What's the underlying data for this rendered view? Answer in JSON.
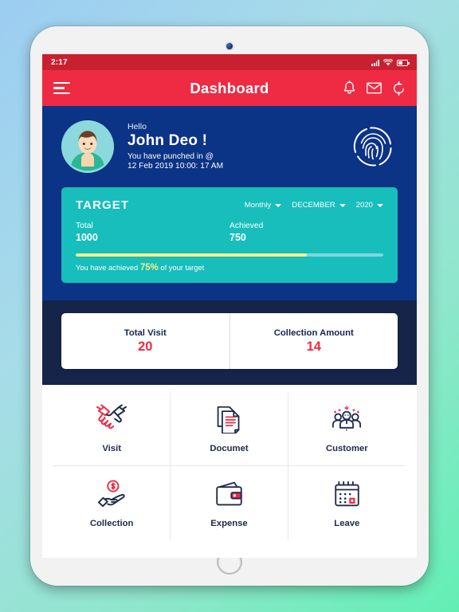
{
  "status_bar": {
    "time": "2:17",
    "signal_icon": "signal-bars-icon",
    "wifi_icon": "wifi-icon",
    "battery_icon": "battery-icon"
  },
  "app_bar": {
    "menu_icon": "hamburger-menu-icon",
    "title": "Dashboard",
    "notification_icon": "bell-icon",
    "mail_icon": "envelope-icon",
    "refresh_icon": "refresh-icon"
  },
  "profile": {
    "avatar_icon": "user-avatar",
    "hello": "Hello",
    "name": "John Deo !",
    "punch_line1": "You have punched in @",
    "punch_line2": "12 Feb 2019 10:00: 17 AM",
    "fingerprint_icon": "fingerprint-icon"
  },
  "target": {
    "title": "TARGET",
    "period": "Monthly",
    "month": "DECEMBER",
    "year": "2020",
    "total_label": "Total",
    "total_value": "1000",
    "achieved_label": "Achieved",
    "achieved_value": "750",
    "progress_percent": 75,
    "note_prefix": "You have achieved ",
    "note_percent": "75%",
    "note_suffix": " of your target"
  },
  "stats": [
    {
      "label": "Total Visit",
      "value": "20"
    },
    {
      "label": "Collection Amount",
      "value": "14"
    }
  ],
  "menu": [
    {
      "label": "Visit",
      "icon": "handshake-icon"
    },
    {
      "label": "Documet",
      "icon": "documents-icon"
    },
    {
      "label": "Customer",
      "icon": "customer-group-icon"
    },
    {
      "label": "Collection",
      "icon": "hand-coin-icon"
    },
    {
      "label": "Expense",
      "icon": "wallet-icon"
    },
    {
      "label": "Leave",
      "icon": "calendar-icon"
    }
  ],
  "colors": {
    "primary_red": "#EE2B43",
    "status_red": "#C9202F",
    "profile_blue": "#0B3386",
    "dark_navy": "#16244A",
    "teal": "#17BEBB",
    "progress_yellow": "#F4F08B"
  },
  "device": {
    "camera_icon": "front-camera",
    "home_button_icon": "home-button"
  }
}
